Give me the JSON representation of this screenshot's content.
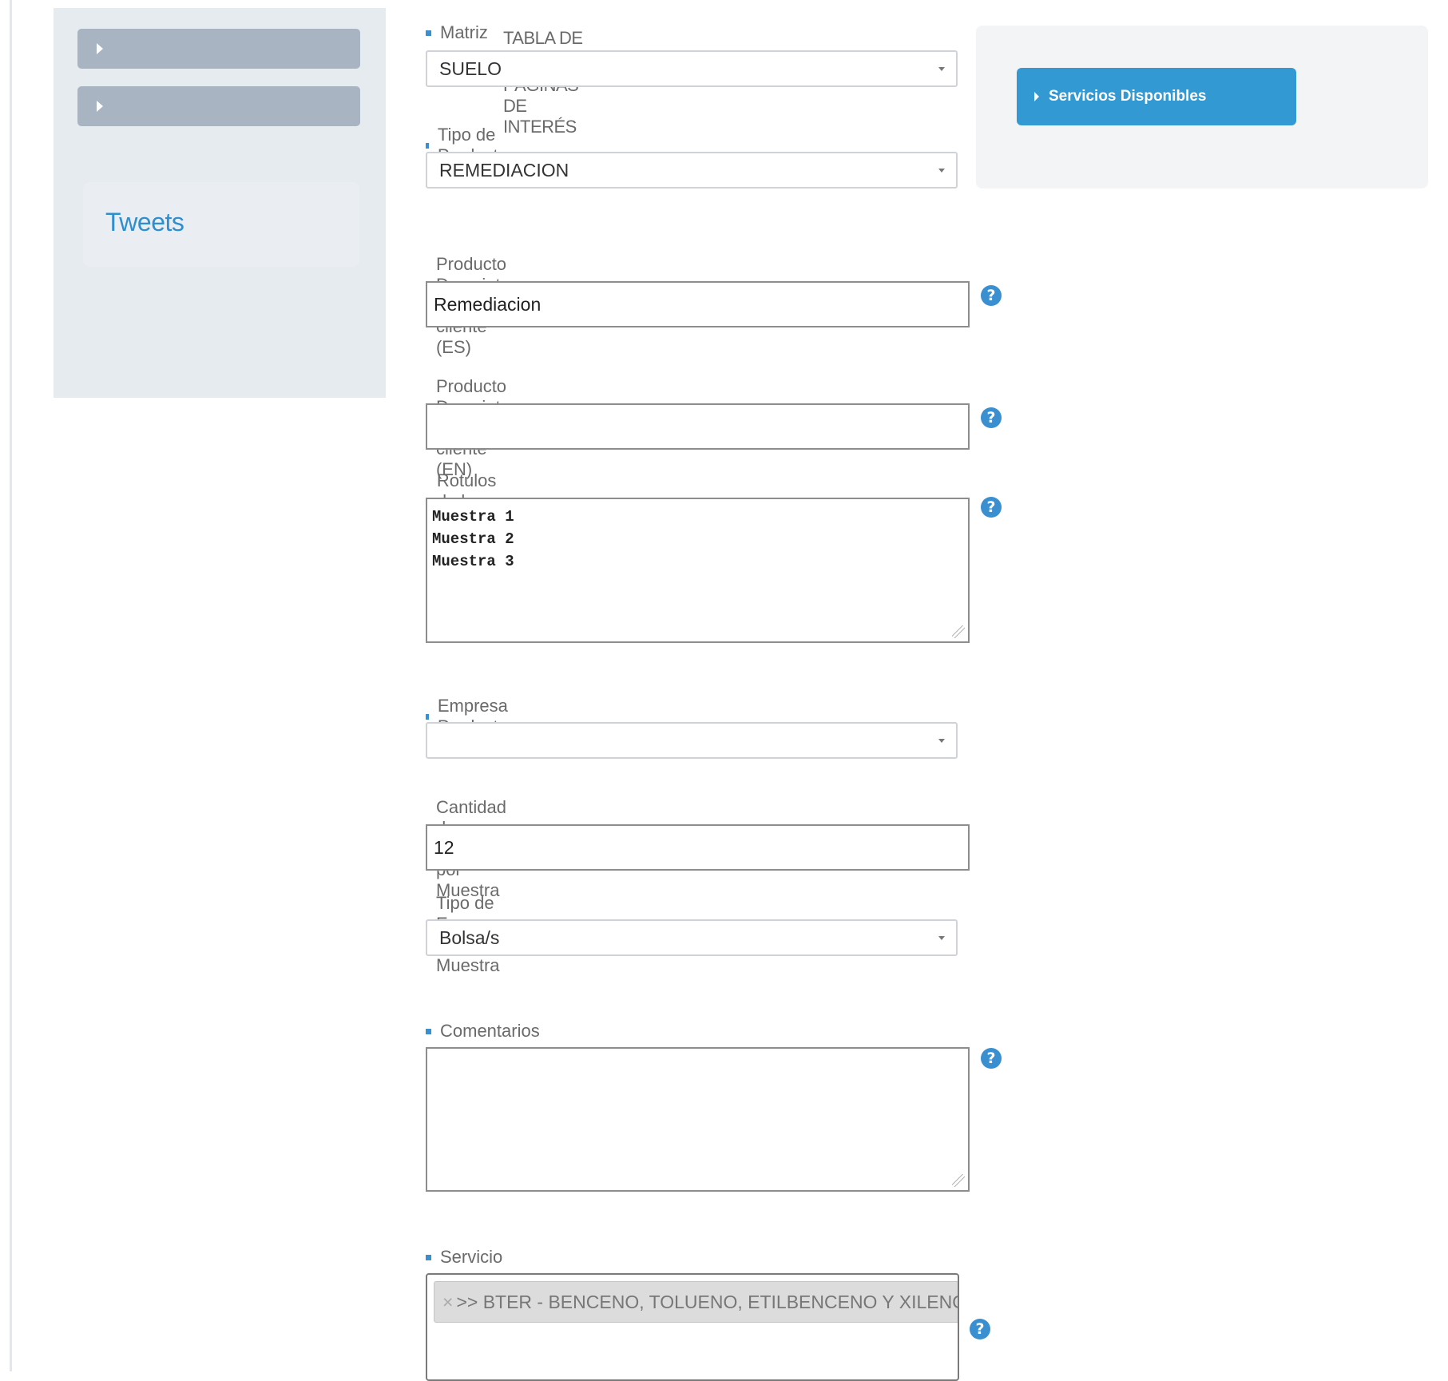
{
  "sidebar": {
    "buttons": [
      {
        "label": "TABLA DE TOLERANCIAS",
        "icon": "chevron-right-icon"
      },
      {
        "label": "PÁGINAS DE INTERÉS",
        "icon": "chevron-right-icon"
      }
    ],
    "tweets_label": "Tweets"
  },
  "right_panel": {
    "services_button": "Servicios Disponibles"
  },
  "form": {
    "matriz": {
      "label": "Matriz",
      "value": "SUELO"
    },
    "tipo_producto": {
      "label": "Tipo de Producto",
      "value": "REMEDIACION"
    },
    "producto_es": {
      "label": "Producto Descripto por cliente (ES)",
      "value": "Remediacion"
    },
    "producto_en": {
      "label": "Producto Descripto por cliente (EN)",
      "value": ""
    },
    "rotulos": {
      "label": "Rotulos de las Muestras",
      "value": "Muestra 1\nMuestra 2\nMuestra 3"
    },
    "empresa": {
      "label": "Empresa Productora",
      "value": ""
    },
    "cantidad": {
      "label": "Cantidad de Envases por Muestra",
      "value": "12"
    },
    "tipo_envase": {
      "label": "Tipo de Envase de la Muestra",
      "value": "Bolsa/s"
    },
    "comentarios": {
      "label": "Comentarios",
      "value": ""
    },
    "servicio": {
      "label": "Servicio",
      "remove_glyph": "×",
      "selected": ">> BTER - BENCENO, TOLUENO, ETILBENCENO Y XILENOS"
    }
  },
  "help_icon": {
    "glyph": "?",
    "icon": "help-icon"
  },
  "colors": {
    "accent": "#3399d3",
    "sidebar_bg": "#e6ebf0",
    "side_button": "#a8b4c2",
    "tweets": "#2e8fcf"
  }
}
